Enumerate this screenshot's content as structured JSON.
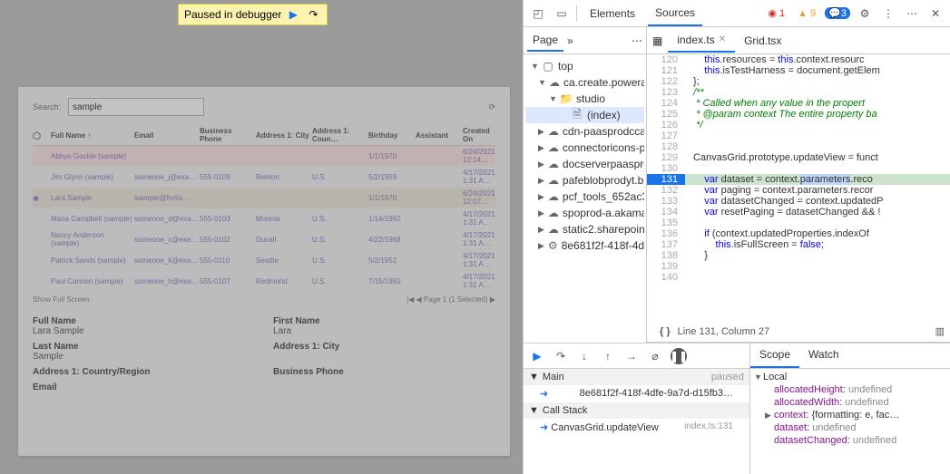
{
  "paused_pill": {
    "text": "Paused in debugger"
  },
  "app": {
    "search_label": "Search:",
    "search_value": "sample",
    "columns": [
      "Full Name ↑",
      "Email",
      "Business Phone",
      "Address 1: City",
      "Address 1: Coun…",
      "Birthday",
      "Assistant",
      "Created On"
    ],
    "rows": [
      {
        "name": "Abbye Gockle (sample)",
        "email": "",
        "phone": "",
        "city": "",
        "country": "",
        "birthday": "1/1/1970",
        "assistant": "",
        "created": "6/24/2021 12:14…"
      },
      {
        "name": "Jim Glynn (sample)",
        "email": "someone_j@exa…",
        "phone": "555-0109",
        "city": "Renton",
        "country": "U.S.",
        "birthday": "5/2/1959",
        "assistant": "",
        "created": "4/17/2021 1:31 A…"
      },
      {
        "name": "Lara Sample",
        "email": "lsample@fortis…",
        "phone": "",
        "city": "",
        "country": "",
        "birthday": "1/1/1970",
        "assistant": "",
        "created": "6/24/2021 12:07…"
      },
      {
        "name": "Maria Campbell (sample)",
        "email": "someone_d@exa…",
        "phone": "555-0103",
        "city": "Monroe",
        "country": "U.S.",
        "birthday": "1/14/1962",
        "assistant": "",
        "created": "4/17/2021 1:31 A…"
      },
      {
        "name": "Nancy Anderson (sample)",
        "email": "someone_c@exa…",
        "phone": "555-0102",
        "city": "Duvall",
        "country": "U.S.",
        "birthday": "4/22/1968",
        "assistant": "",
        "created": "4/17/2021 1:31 A…"
      },
      {
        "name": "Patrick Sands (sample)",
        "email": "someone_k@exa…",
        "phone": "555-0110",
        "city": "Seattle",
        "country": "U.S.",
        "birthday": "5/2/1952",
        "assistant": "",
        "created": "4/17/2021 1:31 A…"
      },
      {
        "name": "Paul Cannon (sample)",
        "email": "someone_h@exa…",
        "phone": "555-0107",
        "city": "Redmond",
        "country": "U.S.",
        "birthday": "7/15/1950",
        "assistant": "",
        "created": "4/17/2021 1:31 A…"
      }
    ],
    "grid_footer_hint": "Show Full Screen",
    "grid_footer_page": "|◀ ◀ Page 1 (1 Selected) ▶",
    "form": {
      "full_name_lbl": "Full Name",
      "full_name_val": "Lara Sample",
      "first_name_lbl": "First Name",
      "first_name_val": "Lara",
      "last_name_lbl": "Last Name",
      "last_name_val": "Sample",
      "address_city_lbl": "Address 1: City",
      "address_country_lbl": "Address 1: Country/Region",
      "business_phone_lbl": "Business Phone",
      "email_lbl": "Email"
    }
  },
  "devtools": {
    "top_tabs": {
      "elements": "Elements",
      "sources": "Sources"
    },
    "badges": {
      "errors": "1",
      "warnings": "9",
      "info": "3"
    },
    "page_tab": "Page",
    "tree": {
      "top": "top",
      "domains": [
        "ca.create.powera…",
        "cdn-paasprodcca…",
        "connectoricons-p…",
        "docserverpaaspro…",
        "pafeblobprodyt.b…",
        "pcf_tools_652ac3…",
        "spoprod-a.akama…",
        "static2.sharepoin…",
        "8e681f2f-418f-4dfe…"
      ],
      "folder": "studio",
      "file": "(index)"
    },
    "editor_tabs": {
      "active": "index.ts",
      "other": "Grid.tsx"
    },
    "code_lines": [
      {
        "n": 120,
        "t": "     this.resources = this.context.resourc"
      },
      {
        "n": 121,
        "t": "     this.isTestHarness = document.getElem"
      },
      {
        "n": 122,
        "t": " };"
      },
      {
        "n": 123,
        "t": " /**"
      },
      {
        "n": 124,
        "t": "  * Called when any value in the propert"
      },
      {
        "n": 125,
        "t": "  * @param context The entire property ba"
      },
      {
        "n": 126,
        "t": "  */"
      },
      {
        "n": 127,
        "t": ""
      },
      {
        "n": 128,
        "t": ""
      },
      {
        "n": 129,
        "t": " CanvasGrid.prototype.updateView = funct"
      },
      {
        "n": 130,
        "t": ""
      },
      {
        "n": 131,
        "t": "     var dataset = context.parameters.reco",
        "paused": true
      },
      {
        "n": 132,
        "t": "     var paging = context.parameters.recor"
      },
      {
        "n": 133,
        "t": "     var datasetChanged = context.updatedP"
      },
      {
        "n": 134,
        "t": "     var resetPaging = datasetChanged && !"
      },
      {
        "n": 135,
        "t": ""
      },
      {
        "n": 136,
        "t": "     if (context.updatedProperties.indexOf"
      },
      {
        "n": 137,
        "t": "         this.isFullScreen = false;"
      },
      {
        "n": 138,
        "t": "     }"
      },
      {
        "n": 139,
        "t": ""
      },
      {
        "n": 140,
        "t": ""
      }
    ],
    "status": "Line 131, Column 27",
    "threads": {
      "head": "Main",
      "state": "paused",
      "row": "8e681f2f-418f-4dfe-9a7d-d15fb3…"
    },
    "callstack": {
      "head": "Call Stack",
      "frame": "CanvasGrid.updateView",
      "loc": "index.ts:131"
    },
    "scope": {
      "tab_scope": "Scope",
      "tab_watch": "Watch",
      "local": "Local",
      "vars": [
        {
          "name": "allocatedHeight",
          "val": "undefined"
        },
        {
          "name": "allocatedWidth",
          "val": "undefined"
        },
        {
          "name": "context",
          "val": "{formatting: e, fac…",
          "obj": true
        },
        {
          "name": "dataset",
          "val": "undefined"
        },
        {
          "name": "datasetChanged",
          "val": "undefined"
        }
      ]
    }
  }
}
